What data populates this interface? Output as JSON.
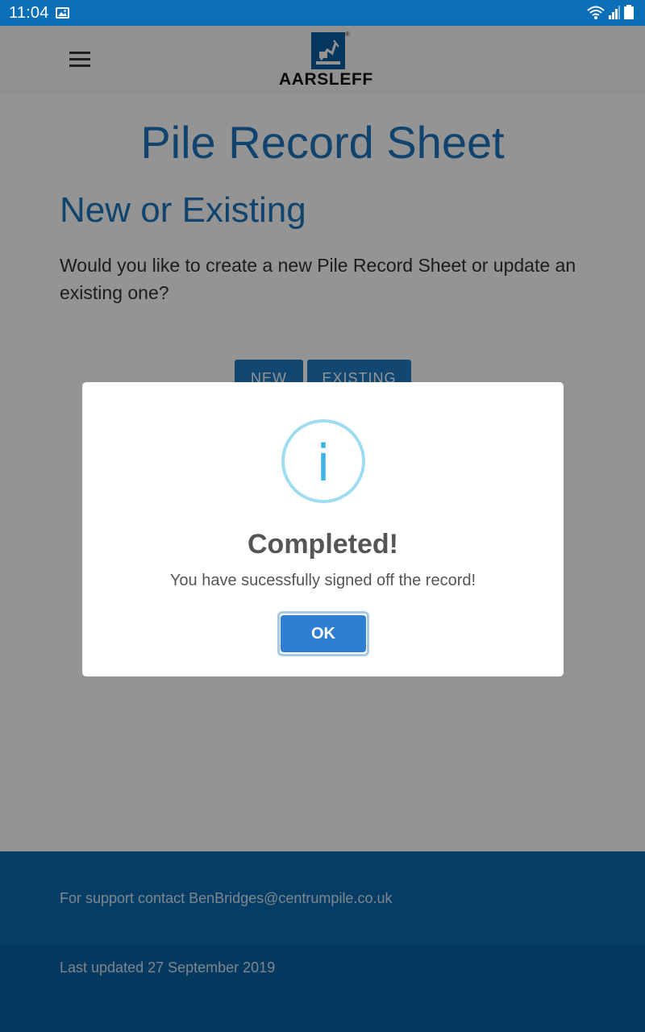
{
  "status_bar": {
    "time": "11:04",
    "icons": [
      "gallery-icon",
      "wifi-icon",
      "signal-icon",
      "battery-icon"
    ]
  },
  "app_bar": {
    "menu_icon": "hamburger-menu-icon",
    "logo_text": "AARSLEFF",
    "logo_reg": "®"
  },
  "main": {
    "page_title": "Pile Record Sheet",
    "section_title": "New or Existing",
    "question": "Would you like to create a new Pile Record Sheet or update an existing one?",
    "buttons": {
      "new_label": "NEW",
      "existing_label": "EXISTING"
    }
  },
  "footer": {
    "support_text": "For support contact BenBridges@centrumpile.co.uk",
    "updated_text": "Last updated 27 September 2019"
  },
  "dialog": {
    "icon": "info-icon",
    "icon_glyph": "i",
    "title": "Completed!",
    "message": "You have sucessfully signed off the record!",
    "ok_label": "OK"
  },
  "colors": {
    "status_bar": "#0b6fb8",
    "brand_blue": "#1d74bc",
    "footer": "#0b6ab0",
    "ok_button": "#2d7fd3",
    "info_ring": "#9fdcf0"
  }
}
